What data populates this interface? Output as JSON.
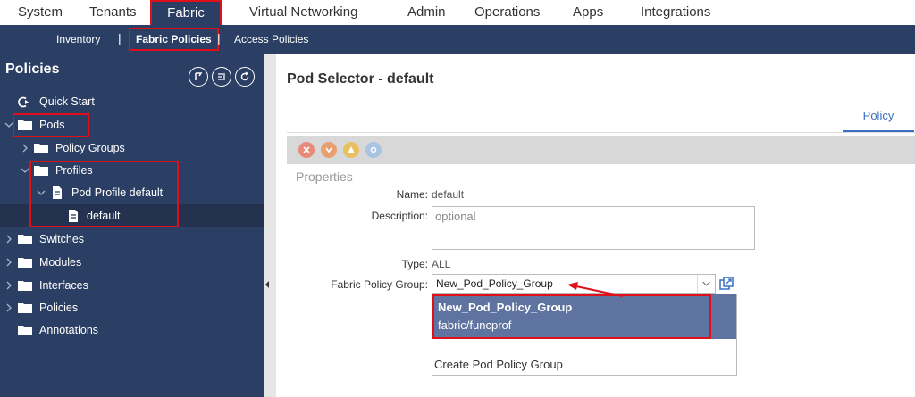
{
  "top_nav": [
    "System",
    "Tenants",
    "Fabric",
    "Virtual Networking",
    "Admin",
    "Operations",
    "Apps",
    "Integrations"
  ],
  "sub_nav": {
    "inventory": "Inventory",
    "fabric_policies": "Fabric Policies",
    "access_policies": "Access Policies",
    "separator": "|"
  },
  "sidebar": {
    "title": "Policies",
    "tree": {
      "quick_start": "Quick Start",
      "pods": "Pods",
      "policy_groups": "Policy Groups",
      "profiles": "Profiles",
      "pod_profile_default": "Pod Profile default",
      "default": "default",
      "switches": "Switches",
      "modules": "Modules",
      "interfaces": "Interfaces",
      "policies": "Policies",
      "annotations": "Annotations"
    }
  },
  "main": {
    "title": "Pod Selector - default",
    "tab": "Policy",
    "properties_header": "Properties",
    "fields": {
      "name_label": "Name:",
      "name_value": "default",
      "description_label": "Description:",
      "description_placeholder": "optional",
      "type_label": "Type:",
      "type_value": "ALL",
      "fabric_policy_group_label": "Fabric Policy Group:",
      "fabric_policy_group_value": "New_Pod_Policy_Group"
    },
    "dropdown": {
      "selected_title": "New_Pod_Policy_Group",
      "selected_subtitle": "fabric/funcprof",
      "create_option": "Create Pod Policy Group"
    }
  },
  "colors": {
    "nav_dark": "#2b3e63",
    "annotation_red": "#e0101b",
    "dropdown_selected": "#5f73a0",
    "tab_blue": "#3a6fc4"
  }
}
